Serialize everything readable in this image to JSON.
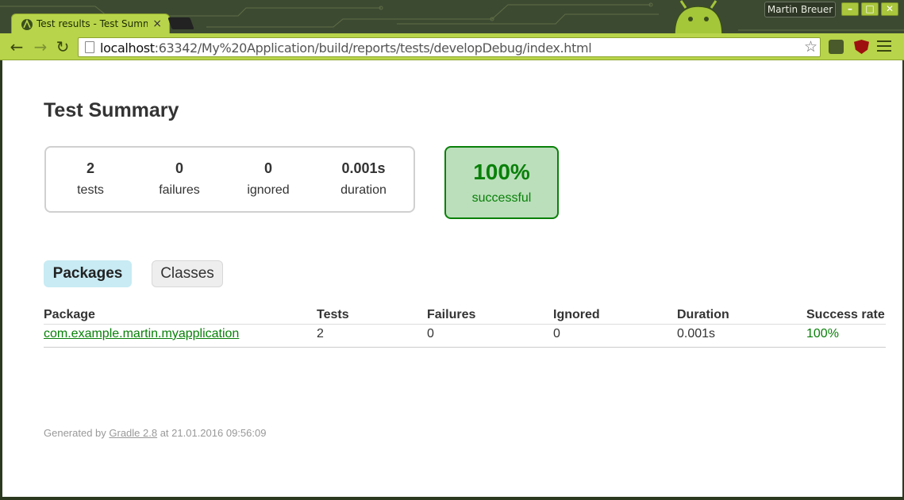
{
  "browser": {
    "tab_title": "Test results - Test Summ",
    "tab_close": "×",
    "profile_name": "Martin Breuer",
    "window_buttons": {
      "minimize": "–",
      "maximize": "□",
      "close": "✕"
    },
    "nav": {
      "back": "←",
      "forward": "→",
      "reload": "↻"
    },
    "url_host": "localhost",
    "url_rest": ":63342/My%20Application/build/reports/tests/developDebug/index.html",
    "bookmark_star": "☆",
    "accent_color": "#b8d44a"
  },
  "report": {
    "title": "Test Summary",
    "counters": {
      "tests": {
        "value": "2",
        "label": "tests"
      },
      "failures": {
        "value": "0",
        "label": "failures"
      },
      "ignored": {
        "value": "0",
        "label": "ignored"
      },
      "duration": {
        "value": "0.001s",
        "label": "duration"
      }
    },
    "success": {
      "rate": "100%",
      "label": "successful",
      "color": "#098009"
    },
    "tabs": {
      "packages": "Packages",
      "classes": "Classes"
    },
    "table": {
      "headers": [
        "Package",
        "Tests",
        "Failures",
        "Ignored",
        "Duration",
        "Success rate"
      ],
      "rows": [
        {
          "package": "com.example.martin.myapplication",
          "tests": "2",
          "failures": "0",
          "ignored": "0",
          "duration": "0.001s",
          "success_rate": "100%"
        }
      ]
    },
    "footer": {
      "prefix": "Generated by ",
      "link": "Gradle 2.8",
      "suffix": " at 21.01.2016 09:56:09"
    }
  }
}
